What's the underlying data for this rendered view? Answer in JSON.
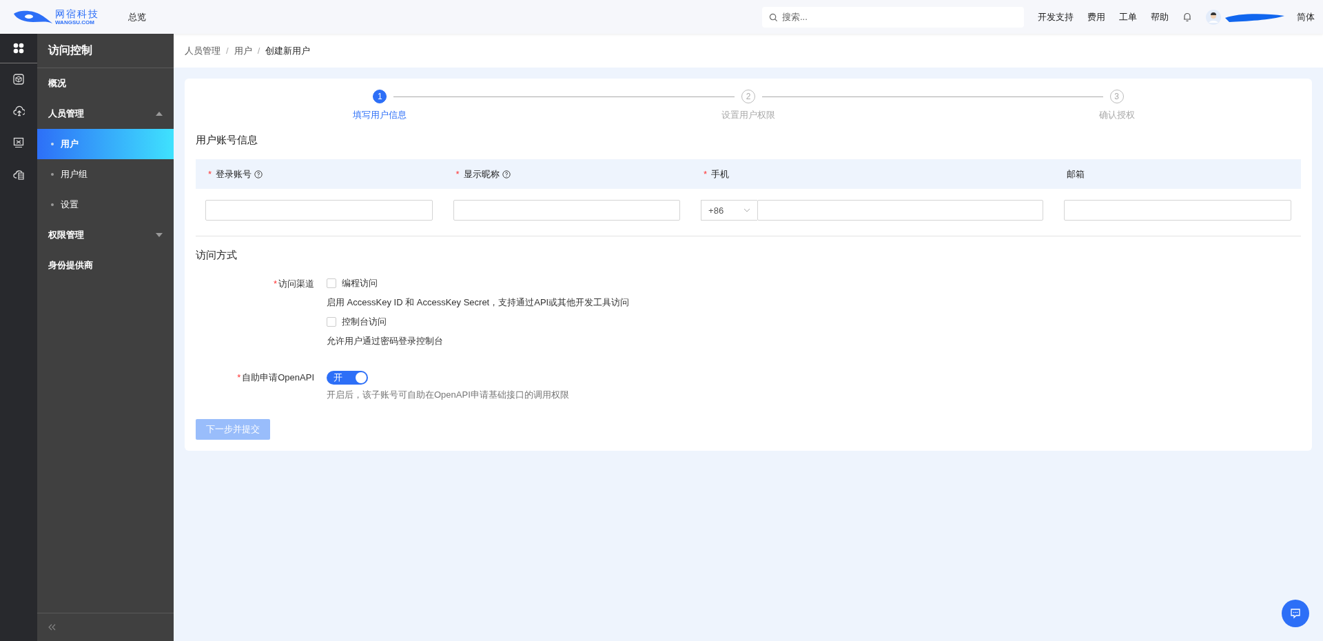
{
  "header": {
    "logo_cn": "网宿科技",
    "logo_en": "WANGSU.COM",
    "nav": [
      {
        "label": "总览"
      }
    ],
    "search": {
      "placeholder": "搜索..."
    },
    "links": [
      "开发支持",
      "费用",
      "工单",
      "帮助"
    ],
    "language": "简体"
  },
  "rail": [
    {
      "kind": "apps",
      "selected": true
    },
    {
      "kind": "cube",
      "selected": false
    },
    {
      "kind": "cloud-upload",
      "selected": false
    },
    {
      "kind": "monitor",
      "selected": false
    },
    {
      "kind": "cloud-db",
      "selected": false
    }
  ],
  "sidebar": {
    "title": "访问控制",
    "items": [
      {
        "label": "概况",
        "kind": "link"
      },
      {
        "label": "人员管理",
        "kind": "group",
        "expanded": true,
        "children": [
          {
            "label": "用户",
            "selected": true
          },
          {
            "label": "用户组",
            "selected": false
          },
          {
            "label": "设置",
            "selected": false
          }
        ]
      },
      {
        "label": "权限管理",
        "kind": "group",
        "expanded": false
      },
      {
        "label": "身份提供商",
        "kind": "link"
      }
    ]
  },
  "breadcrumb": [
    {
      "label": "人员管理"
    },
    {
      "separator": "/",
      "label": "用户"
    },
    {
      "separator": "/",
      "label": "创建新用户"
    }
  ],
  "steps": [
    {
      "number": "1",
      "label": "填写用户信息",
      "selected": true
    },
    {
      "number": "2",
      "label": "设置用户权限",
      "selected": false
    },
    {
      "number": "3",
      "label": "确认授权",
      "selected": false
    }
  ],
  "account_section": {
    "title": "用户账号信息",
    "fields": [
      {
        "label": "登录账号",
        "required_mark": "*",
        "help": true,
        "kind": "text"
      },
      {
        "label": "显示昵称",
        "required_mark": "*",
        "help": true,
        "kind": "text"
      },
      {
        "label": "手机",
        "required_mark": "*",
        "help": false,
        "kind": "phone",
        "country_code": "+86"
      },
      {
        "label": "邮箱",
        "help": false,
        "kind": "text"
      }
    ]
  },
  "access_section": {
    "title": "访问方式",
    "channel": {
      "label": "访问渠道",
      "required_mark": "*",
      "options": [
        {
          "label": "编程访问",
          "checked": false,
          "description": "启用 AccessKey ID 和 AccessKey Secret，支持通过API或其他开发工具访问"
        },
        {
          "label": "控制台访问",
          "checked": false,
          "description": "允许用户通过密码登录控制台"
        }
      ]
    },
    "openapi": {
      "label": "自助申请OpenAPI",
      "required_mark": "*",
      "on": true,
      "switch_text": "开",
      "description": "开启后，该子账号可自助在OpenAPI申请基础接口的调用权限"
    }
  },
  "submit_button": {
    "label": "下一步并提交",
    "disabled": true
  }
}
